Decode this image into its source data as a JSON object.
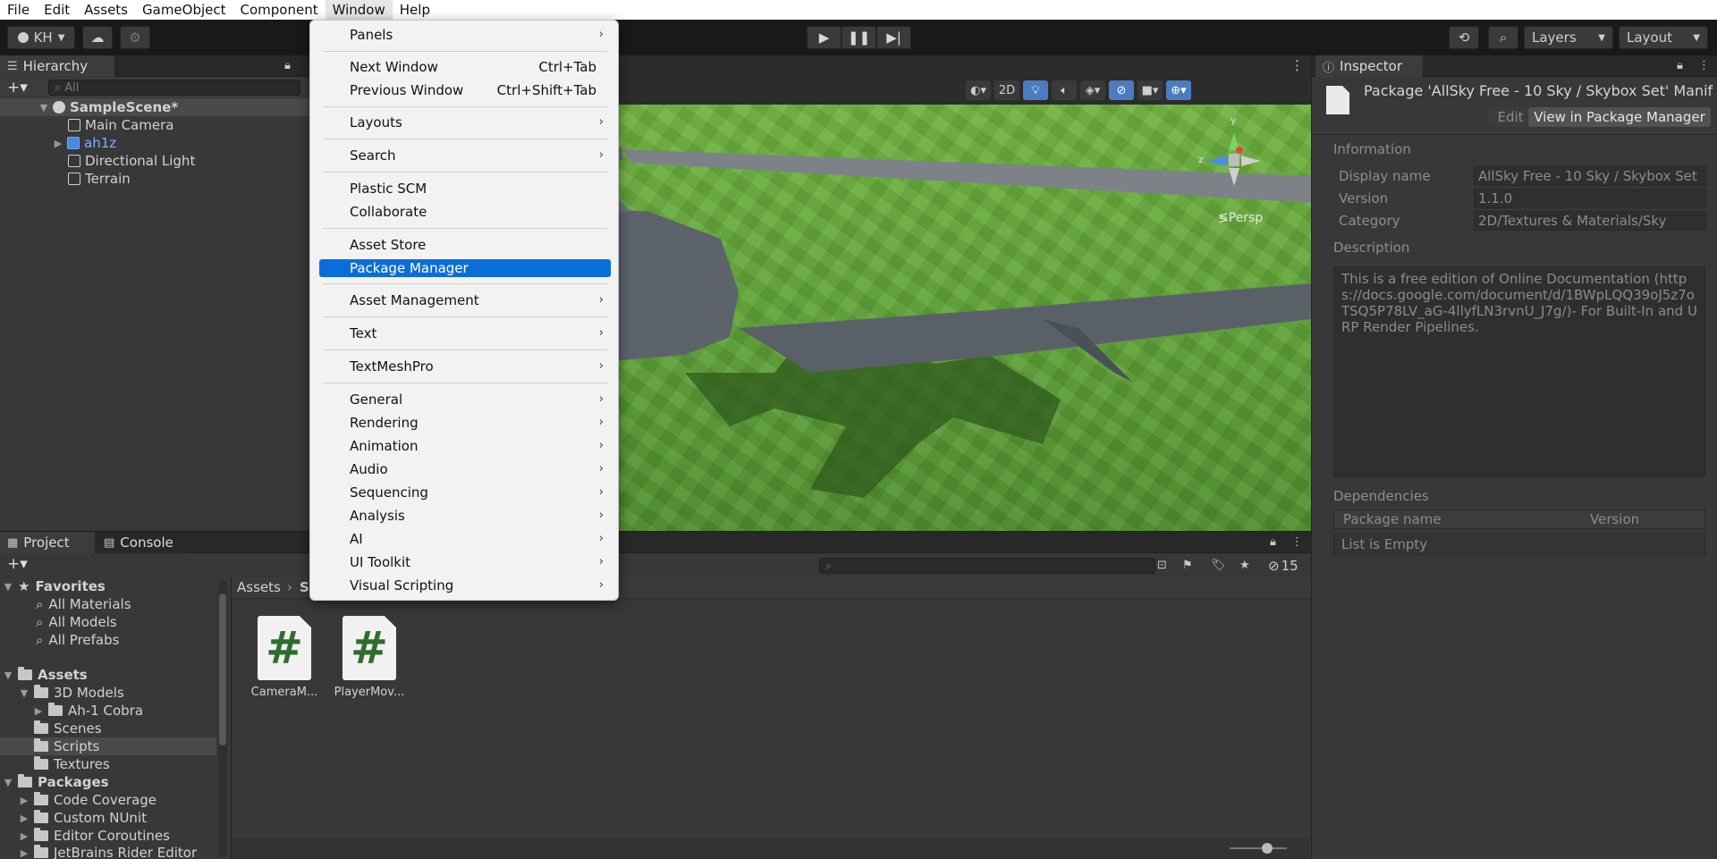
{
  "menubar": [
    "File",
    "Edit",
    "Assets",
    "GameObject",
    "Component",
    "Window",
    "Help"
  ],
  "toolbar": {
    "account": "KH",
    "layers": "Layers",
    "layout": "Layout"
  },
  "hierarchy": {
    "tab": "Hierarchy",
    "search_placeholder": "All",
    "scene": "SampleScene*",
    "items": [
      "Main Camera",
      "ah1z",
      "Directional Light",
      "Terrain"
    ]
  },
  "scene_toolbar": {
    "mode_2d": "2D",
    "persp": "≶Persp",
    "axis_y": "y",
    "axis_z": "z"
  },
  "inspector": {
    "tab": "Inspector",
    "title": "Package 'AllSky Free - 10 Sky / Skybox Set' Manif",
    "edit": "Edit",
    "view_pm": "View in Package Manager",
    "information": "Information",
    "display_name_label": "Display name",
    "display_name": "AllSky Free - 10 Sky / Skybox Set",
    "version_label": "Version",
    "version": "1.1.0",
    "category_label": "Category",
    "category": "2D/Textures & Materials/Sky",
    "description_label": "Description",
    "description": "This is a free edition of Online Documentation (https://docs.google.com/document/d/1BWpLQQ39oJ5z7oTSQ5P78LV_aG-4llyfLN3rvnU_J7g/)- For Built-In and URP Render Pipelines.",
    "dependencies": "Dependencies",
    "dep_package": "Package name",
    "dep_version": "Version",
    "empty": "List is Empty"
  },
  "project": {
    "tab_project": "Project",
    "tab_console": "Console",
    "favorites": "Favorites",
    "fav_items": [
      "All Materials",
      "All Models",
      "All Prefabs"
    ],
    "assets": "Assets",
    "asset_folders": [
      "3D Models",
      "Ah-1 Cobra",
      "Scenes",
      "Scripts",
      "Textures"
    ],
    "packages": "Packages",
    "package_items": [
      "Code Coverage",
      "Custom NUnit",
      "Editor Coroutines",
      "JetBrains Rider Editor"
    ],
    "breadcrumb_root": "Assets",
    "breadcrumb_current": "S",
    "files": [
      "CameraM...",
      "PlayerMov..."
    ],
    "hidden_count": "15",
    "file_glyph": "#"
  },
  "window_menu": {
    "panels": "Panels",
    "next_window": "Next Window",
    "next_window_sc": "Ctrl+Tab",
    "previous_window": "Previous Window",
    "previous_window_sc": "Ctrl+Shift+Tab",
    "layouts": "Layouts",
    "search": "Search",
    "plastic": "Plastic SCM",
    "collaborate": "Collaborate",
    "asset_store": "Asset Store",
    "package_manager": "Package Manager",
    "asset_management": "Asset Management",
    "text": "Text",
    "textmeshpro": "TextMeshPro",
    "general": "General",
    "rendering": "Rendering",
    "animation": "Animation",
    "audio": "Audio",
    "sequencing": "Sequencing",
    "analysis": "Analysis",
    "ai": "AI",
    "ui_toolkit": "UI Toolkit",
    "visual_scripting": "Visual Scripting"
  }
}
